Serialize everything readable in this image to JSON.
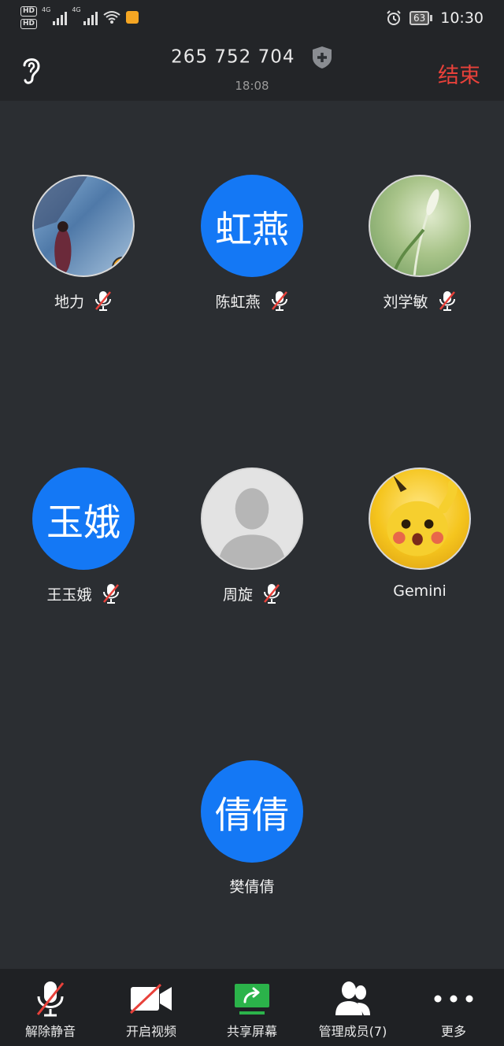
{
  "status": {
    "battery": "63",
    "time": "10:30",
    "net1": "4G",
    "net2": "4G",
    "hd1": "HD",
    "hd2": "HD"
  },
  "header": {
    "meeting_id": "265 752 704",
    "duration": "18:08",
    "end_label": "结束"
  },
  "participants": [
    {
      "name": "地力",
      "muted": true,
      "avatar_type": "photo",
      "host": true
    },
    {
      "name": "陈虹燕",
      "muted": true,
      "avatar_type": "text",
      "avatar_text": "虹燕"
    },
    {
      "name": "刘学敏",
      "muted": true,
      "avatar_type": "photo"
    },
    {
      "name": "王玉娥",
      "muted": true,
      "avatar_type": "text",
      "avatar_text": "玉娥"
    },
    {
      "name": "周旋",
      "muted": true,
      "avatar_type": "default"
    },
    {
      "name": "Gemini",
      "muted": false,
      "avatar_type": "photo"
    },
    {
      "name": "樊倩倩",
      "muted": false,
      "avatar_type": "text",
      "avatar_text": "倩倩"
    }
  ],
  "toolbar": {
    "unmute": "解除静音",
    "video": "开启视频",
    "share": "共享屏幕",
    "members": "管理成员(7)",
    "more": "更多"
  },
  "colors": {
    "accent": "#1478f5",
    "end": "#e8413a",
    "share": "#2bb34a"
  }
}
